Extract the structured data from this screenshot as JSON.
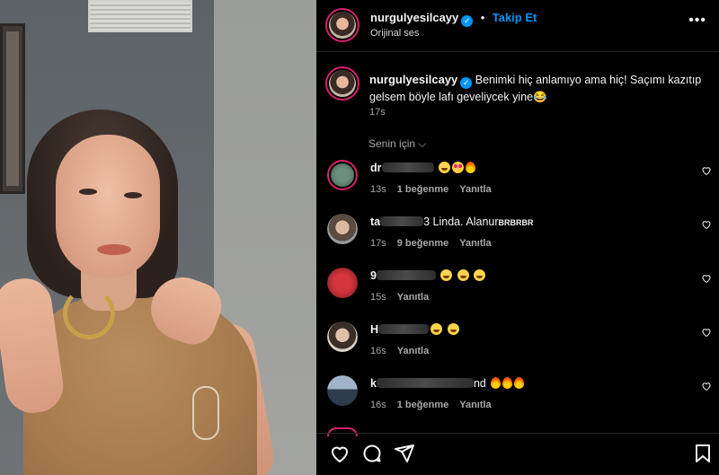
{
  "post": {
    "username": "nurgulyesilcayy",
    "verified_label": "✓",
    "follow_label": "Takip Et",
    "audio_label": "Orijinal ses",
    "more_label": "•••",
    "caption": "Benimki hiç anlamıyo ama hiç! Saçımı kazıtıp gelsem böyle lafı geveliycek yine😂",
    "caption_time": "17s",
    "sort_label": "Senin için ⌵"
  },
  "comments": [
    {
      "user_visible": "dr",
      "text": "",
      "emojis": [
        "laugh",
        "heart-eyes",
        "fire"
      ],
      "time": "13s",
      "likes": "1 beğenme",
      "reply": "Yanıtla"
    },
    {
      "user_visible": "ta",
      "text": "3 Linda. Alanur",
      "text_small": "BRBRBR",
      "emojis": [],
      "time": "17s",
      "likes": "9 beğenme",
      "reply": "Yanıtla"
    },
    {
      "user_visible": "9",
      "text": "",
      "emojis": [
        "laugh",
        "laugh",
        "laugh"
      ],
      "time": "15s",
      "likes": "",
      "reply": "Yanıtla"
    },
    {
      "user_visible": "H",
      "text": "",
      "emojis": [
        "laugh",
        "laugh"
      ],
      "time": "16s",
      "likes": "",
      "reply": "Yanıtla"
    },
    {
      "user_visible": "k",
      "text": "nd",
      "emojis": [
        "fire",
        "fire",
        "fire"
      ],
      "time": "16s",
      "likes": "1 beğenme",
      "reply": "Yanıtla"
    }
  ],
  "colors": {
    "accent": "#0095f6",
    "background": "#000000",
    "muted": "#a8a8a8",
    "story_ring": "#d6206c"
  }
}
